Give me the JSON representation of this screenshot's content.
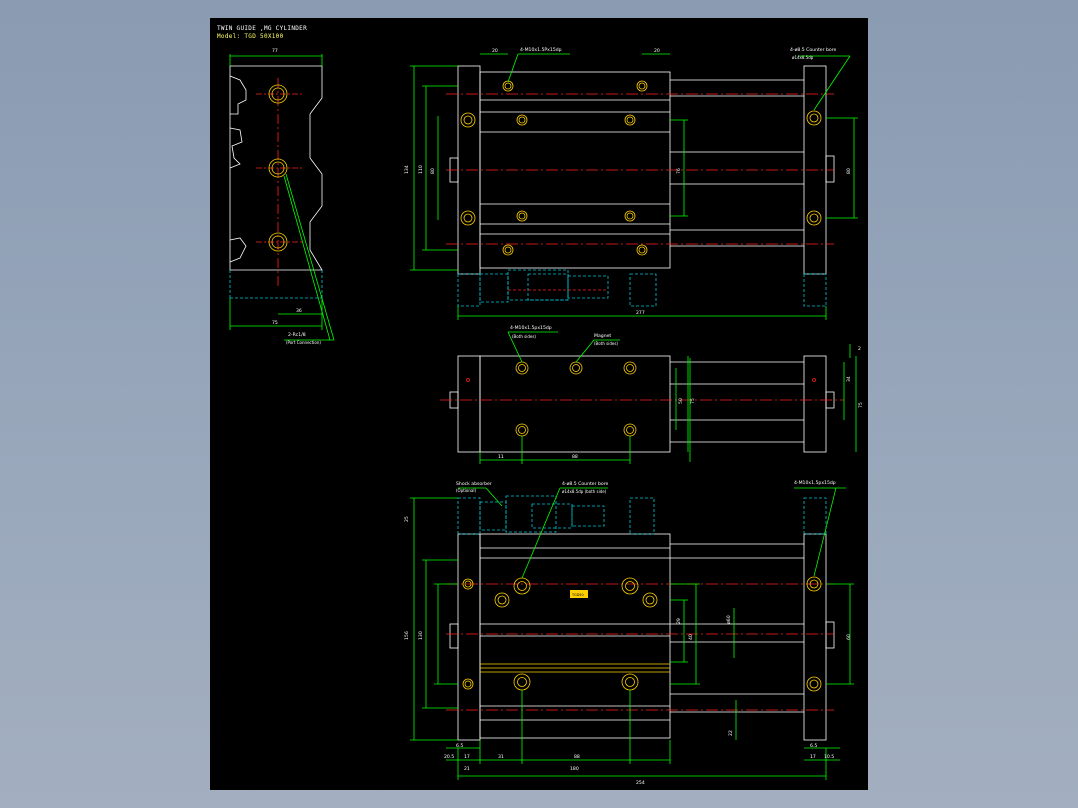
{
  "title": {
    "line1": "TWIN GUIDE ,MG CYLINDER",
    "line2": "Model: TGD 50X100"
  },
  "top_left_view": {
    "dims": {
      "width": "77",
      "bottom": "75",
      "offset": "36"
    },
    "callout": {
      "text": "2-Rc1/8",
      "sub": "(Port Connection)"
    }
  },
  "top_view": {
    "dims": {
      "a": "20",
      "b": "20",
      "c": "134",
      "d": "110",
      "e": "80",
      "f": "76",
      "g": "80",
      "h": "277"
    },
    "callout_left": "4-M10x1.5Px15dp",
    "callout_right": {
      "text": "4-ø8.5 Counter bore",
      "sub": "ø14x8.5dp"
    }
  },
  "middle_view": {
    "callout_left": {
      "text": "4-M10x1.5px15dp",
      "sub": "(Both sides)"
    },
    "callout_mid": {
      "text": "Magnet",
      "sub": "(Both sides)"
    },
    "dims": {
      "a": "11",
      "b": "88",
      "c": "50",
      "d": "34",
      "e": "75",
      "f": "2"
    }
  },
  "bottom_view": {
    "callout_left": {
      "text": "Shock absorber",
      "sub": "(Optional)"
    },
    "callout_mid": {
      "text": "4-ø8.5 Counter bore",
      "sub": "ø14x8.5dp (both side)"
    },
    "callout_right": "4-M10x1.5px15dp",
    "dims": {
      "a": "25",
      "b": "156",
      "c": "130",
      "d": "20",
      "e": "29",
      "f": "40",
      "g": "ø60",
      "h": "60",
      "i": "22",
      "j": "6.5",
      "k": "17",
      "l": "20.5",
      "m": "21",
      "n": "31",
      "o": "88",
      "p": "180",
      "q": "17",
      "r": "10.5",
      "s": "6.5",
      "t": "254"
    },
    "label": "TGD50"
  },
  "colors": {
    "background": "#000000",
    "outline": "#ffffff",
    "dimension": "#00ff00",
    "centerline": "#ff2020",
    "hidden": "#00c8d8",
    "hole": "#ffd000"
  }
}
